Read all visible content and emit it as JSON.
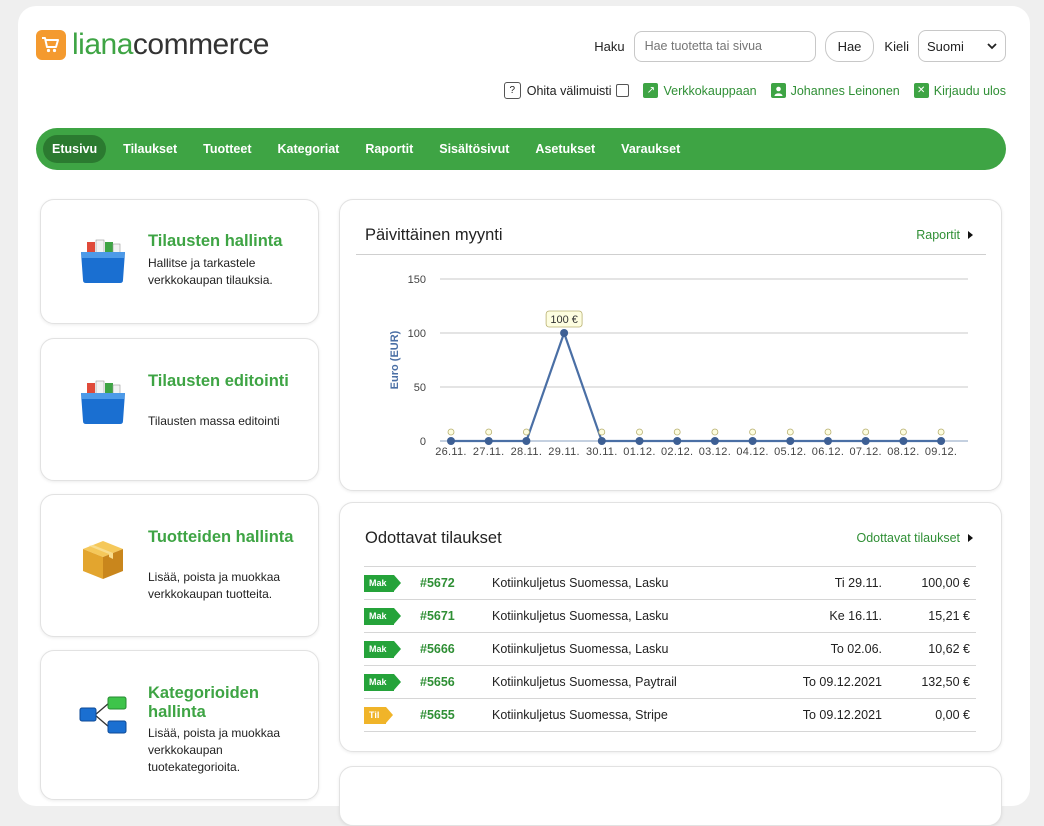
{
  "brand": {
    "part1": "liana",
    "part2": "commerce"
  },
  "header": {
    "search_label": "Haku",
    "search_placeholder": "Hae tuotetta tai sivua",
    "search_button": "Hae",
    "language_label": "Kieli",
    "language_value": "Suomi"
  },
  "utility": {
    "skip_cache_label": "Ohita välimuisti",
    "store_link": "Verkkokauppaan",
    "user_link": "Johannes Leinonen",
    "logout_link": "Kirjaudu ulos"
  },
  "nav": {
    "items": [
      {
        "label": "Etusivu",
        "active": true
      },
      {
        "label": "Tilaukset"
      },
      {
        "label": "Tuotteet"
      },
      {
        "label": "Kategoriat"
      },
      {
        "label": "Raportit"
      },
      {
        "label": "Sisältösivut"
      },
      {
        "label": "Asetukset"
      },
      {
        "label": "Varaukset"
      }
    ]
  },
  "side_cards": [
    {
      "title": "Tilausten hallinta",
      "desc": "Hallitse ja tarkastele verkkokaupan tilauksia.",
      "icon": "order-folder-icon"
    },
    {
      "title": "Tilausten editointi",
      "desc": "Tilausten massa editointi",
      "icon": "order-folder-icon"
    },
    {
      "title": "Tuotteiden hallinta",
      "desc": "Lisää, poista ja muokkaa verkkokaupan tuotteita.",
      "icon": "product-box-icon"
    },
    {
      "title": "Kategorioiden hallinta",
      "desc": "Lisää, poista ja muokkaa verkkokaupan tuotekategorioita.",
      "icon": "category-tree-icon"
    }
  ],
  "sales_panel": {
    "title": "Päivittäinen myynti",
    "link": "Raportit"
  },
  "chart_data": {
    "type": "line",
    "title": "",
    "ylabel": "Euro (EUR)",
    "xlabel": "",
    "ylim": [
      0,
      150
    ],
    "yticks": [
      "0",
      "50",
      "100",
      "150"
    ],
    "categories": [
      "26.11.",
      "27.11.",
      "28.11.",
      "29.11.",
      "30.11.",
      "01.12.",
      "02.12.",
      "03.12.",
      "04.12.",
      "05.12.",
      "06.12.",
      "07.12.",
      "08.12.",
      "09.12."
    ],
    "values": [
      0,
      0,
      0,
      100,
      0,
      0,
      0,
      0,
      0,
      0,
      0,
      0,
      0,
      0
    ],
    "point_labels": [
      "0",
      "0",
      "0",
      "100 €",
      "0",
      "0",
      "0",
      "0",
      "0",
      "0",
      "0",
      "0",
      "0",
      "0"
    ],
    "colors": {
      "line": "#4a6fa5",
      "point": "#3d5f94",
      "tooltip_bg": "#fdfde0"
    },
    "grid": true
  },
  "orders_panel": {
    "title": "Odottavat tilaukset",
    "link": "Odottavat tilaukset",
    "rows": [
      {
        "status": "Mak",
        "id": "#5672",
        "desc": "Kotiinkuljetus Suomessa, Lasku",
        "date": "Ti 29.11.",
        "amount": "100,00 €"
      },
      {
        "status": "Mak",
        "id": "#5671",
        "desc": "Kotiinkuljetus Suomessa, Lasku",
        "date": "Ke 16.11.",
        "amount": "15,21 €"
      },
      {
        "status": "Mak",
        "id": "#5666",
        "desc": "Kotiinkuljetus Suomessa, Lasku",
        "date": "To 02.06.",
        "amount": "10,62 €"
      },
      {
        "status": "Mak",
        "id": "#5656",
        "desc": "Kotiinkuljetus Suomessa, Paytrail",
        "date": "To 09.12.2021",
        "amount": "132,50 €"
      },
      {
        "status": "Til",
        "id": "#5655",
        "desc": "Kotiinkuljetus Suomessa, Stripe",
        "date": "To 09.12.2021",
        "amount": "0,00 €"
      }
    ]
  }
}
